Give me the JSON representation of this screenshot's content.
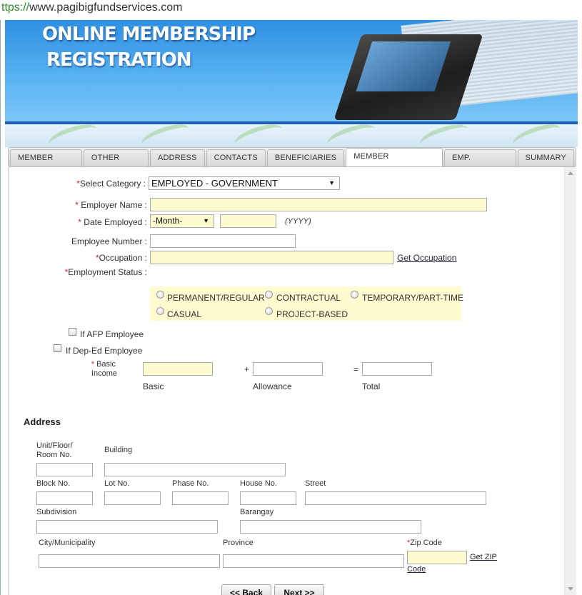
{
  "browser": {
    "url_scheme": "ttps://",
    "url_host": "www.pagibigfundservices.com"
  },
  "banner": {
    "title_line1": "ONLINE MEMBERSHIP",
    "title_line2": "REGISTRATION"
  },
  "tabs": [
    {
      "label": "MEMBER INFO"
    },
    {
      "label": "OTHER INFO"
    },
    {
      "label": "ADDRESS"
    },
    {
      "label": "CONTACTS"
    },
    {
      "label": "BENEFICIARIES"
    },
    {
      "label": "MEMBER CATEGORY",
      "active": true
    },
    {
      "label": "EMP. HISTORY"
    },
    {
      "label": "SUMMARY"
    }
  ],
  "form": {
    "required_mark": "*",
    "select_category_label": "Select Category :",
    "select_category_value": "EMPLOYED - GOVERNMENT",
    "employer_name_label": "Employer Name :",
    "date_employed_label": "Date Employed :",
    "month_select_value": "-Month-",
    "year_hint": "(YYYY)",
    "employee_number_label": "Employee Number :",
    "occupation_label": "Occupation :",
    "get_occupation_link": "Get Occupation",
    "employment_status_label": "Employment Status :",
    "status_options": [
      "PERMANENT/REGULAR",
      "CONTRACTUAL",
      "TEMPORARY/PART-TIME",
      "CASUAL",
      "PROJECT-BASED"
    ],
    "afp_label": "If AFP Employee",
    "deped_label": "If Dep-Ed Employee",
    "basic_income_label_1": "Basic",
    "basic_income_label_2": "Income",
    "plus": "+",
    "equals": "=",
    "basic_caption": "Basic",
    "allowance_caption": "Allowance",
    "total_caption": "Total"
  },
  "address": {
    "title": "Address",
    "unit_floor_room_1": "Unit/Floor/",
    "unit_floor_room_2": "Room No.",
    "building": "Building",
    "block_no": "Block No.",
    "lot_no": "Lot No.",
    "phase_no": "Phase No.",
    "house_no": "House No.",
    "street": "Street",
    "subdivision": "Subdivision",
    "barangay": "Barangay",
    "city": "City/Municipality",
    "province": "Province",
    "zip_code": "Zip Code",
    "get_zip_code_1": "Get ZIP",
    "get_zip_code_2": "Code"
  },
  "buttons": {
    "back": "<< Back",
    "next": "Next >>"
  },
  "colors": {
    "required": "#dd2222",
    "highlight_input": "#fffbd0",
    "banner_blue": "#3a96e4"
  }
}
